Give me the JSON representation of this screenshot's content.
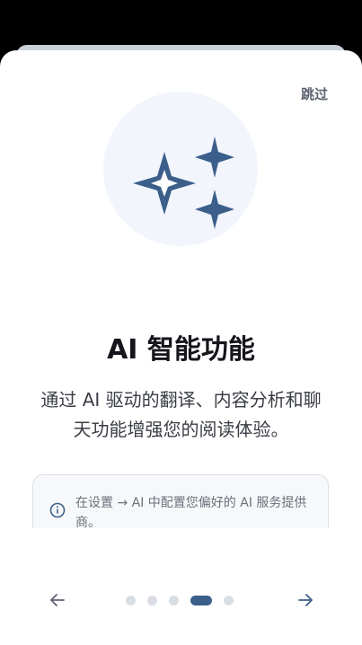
{
  "colors": {
    "accent": "#3b5f8a",
    "hero_bg": "#f2f6fc",
    "dot_inactive": "#d9dde4"
  },
  "onboarding": {
    "skip_label": "跳过",
    "hero_icon": "sparkles-icon",
    "title": "AI 智能功能",
    "description": "通过 AI 驱动的翻译、内容分析和聊天功能增强您的阅读体验。",
    "info": {
      "icon": "info-icon",
      "text": "在设置 → AI 中配置您偏好的 AI 服务提供商。"
    },
    "pagination": {
      "total_pages": 5,
      "current_page": 4
    },
    "prev_icon": "arrow-left-icon",
    "next_icon": "arrow-right-icon"
  }
}
